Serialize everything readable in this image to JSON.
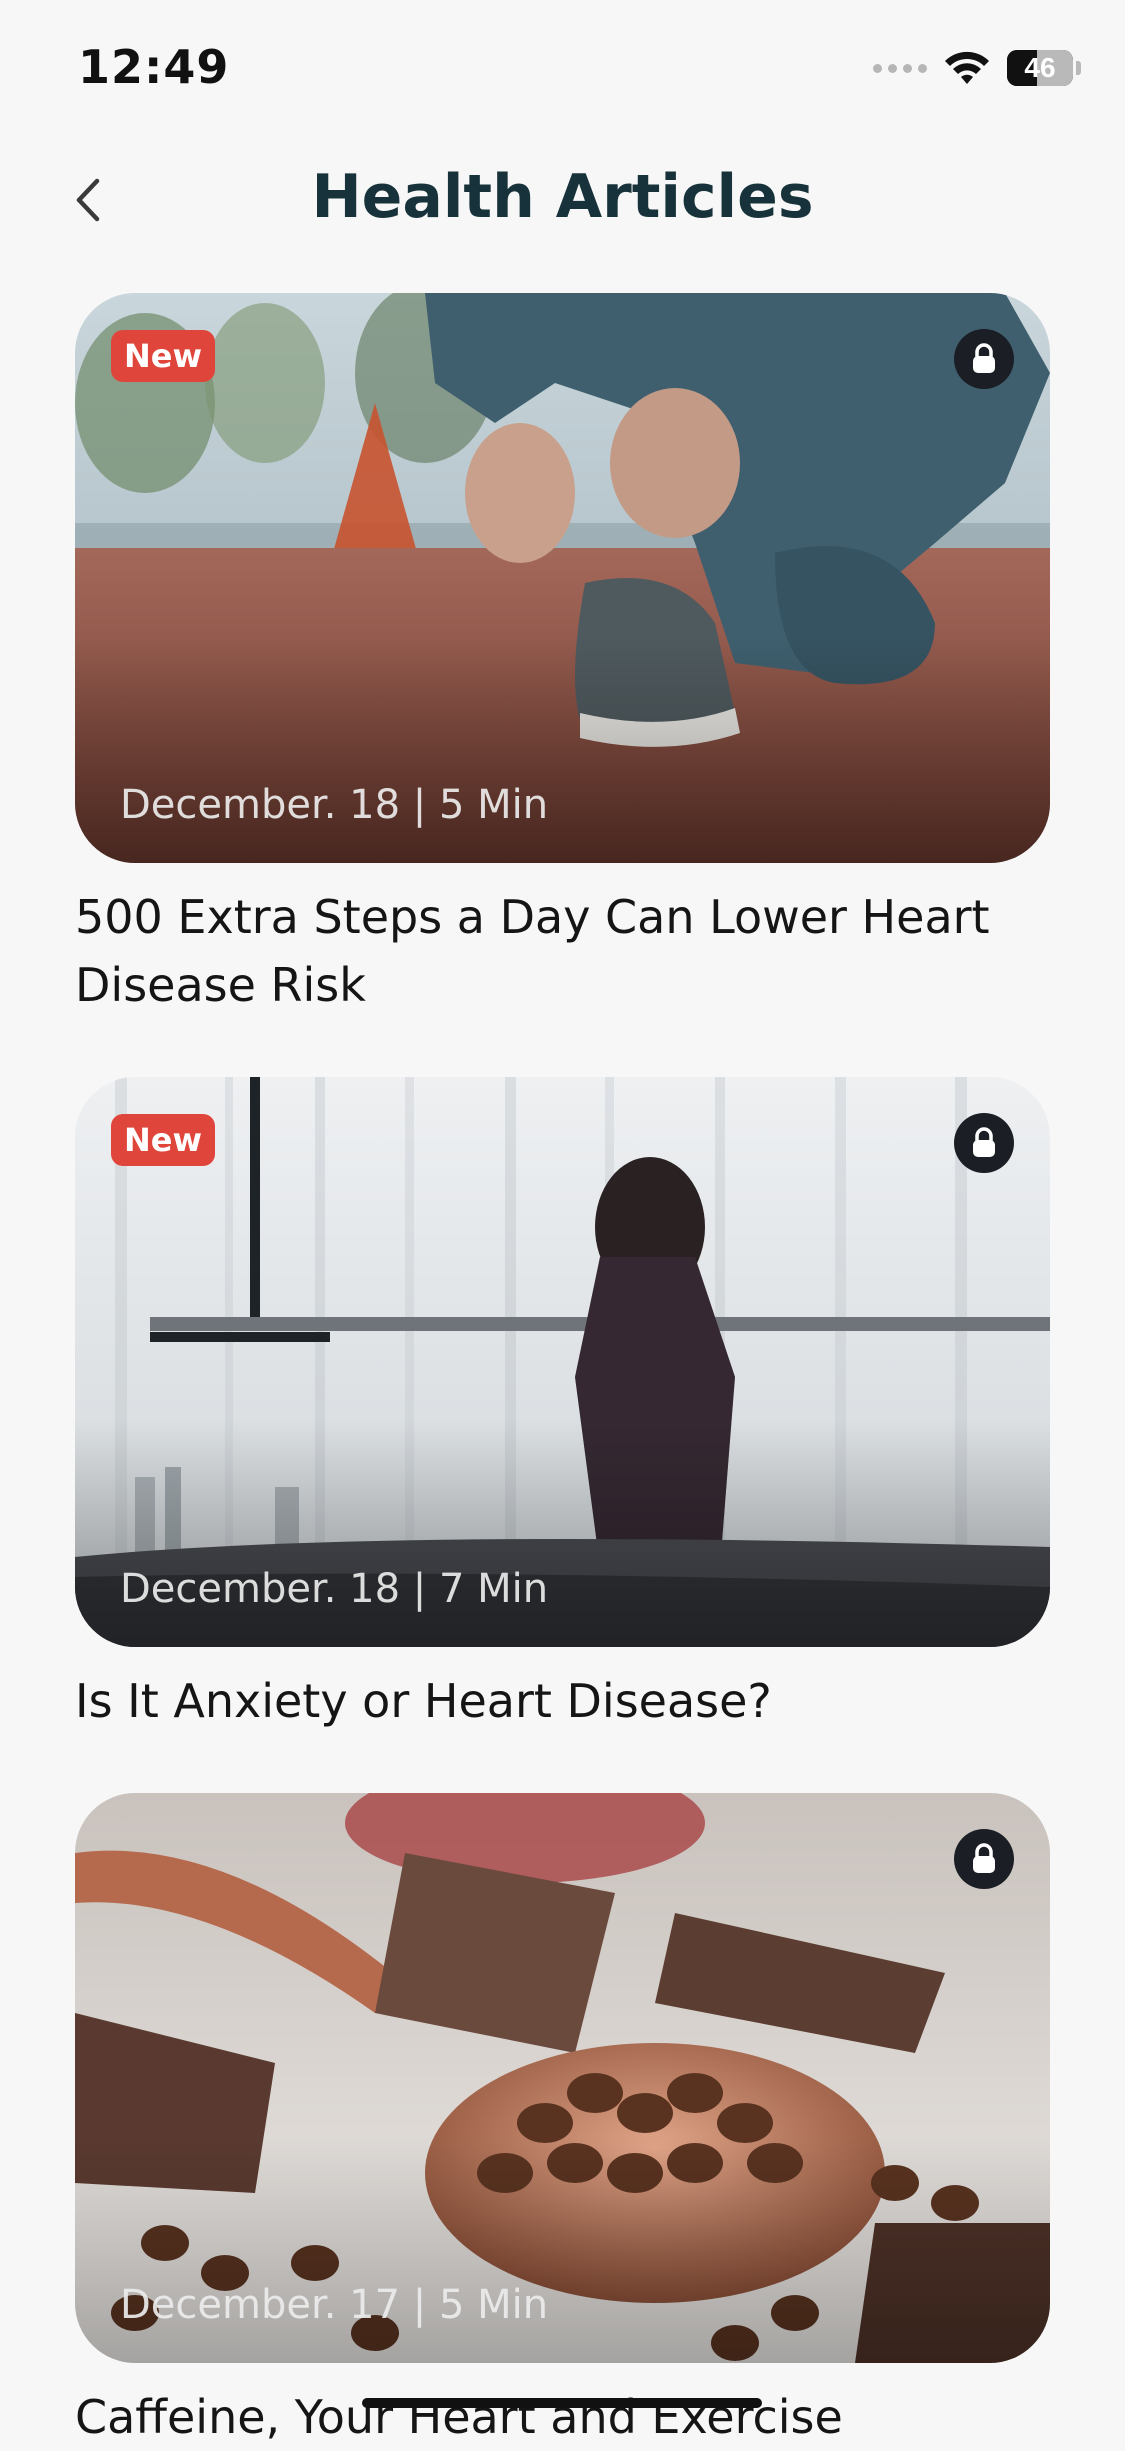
{
  "status_bar": {
    "time": "12:49",
    "battery_level": "46",
    "battery_fraction": 0.46,
    "icons": [
      "signal-dots-icon",
      "wifi-icon",
      "battery-icon"
    ]
  },
  "header": {
    "title": "Health Articles",
    "back_icon": "chevron-left-icon"
  },
  "articles": [
    {
      "badge": "New",
      "meta": "December. 18 | 5 Min",
      "title": "500 Extra Steps a Day Can Lower Heart Disease Risk",
      "locked": true,
      "image": "person tying running shoe on track"
    },
    {
      "badge": "New",
      "meta": "December. 18 | 7 Min",
      "title": "Is It Anxiety or Heart Disease?",
      "locked": true,
      "image": "woman sitting on bed facing window"
    },
    {
      "badge": "",
      "meta": "December. 17 | 5 Min",
      "title": "Caffeine, Your Heart and Exercise",
      "locked": true,
      "image": "coffee beans and chocolate in a copper scoop"
    }
  ],
  "colors": {
    "background": "#f7f7f7",
    "title": "#17323a",
    "badge": "#e0453c",
    "lock_bg": "#1b1e25"
  }
}
